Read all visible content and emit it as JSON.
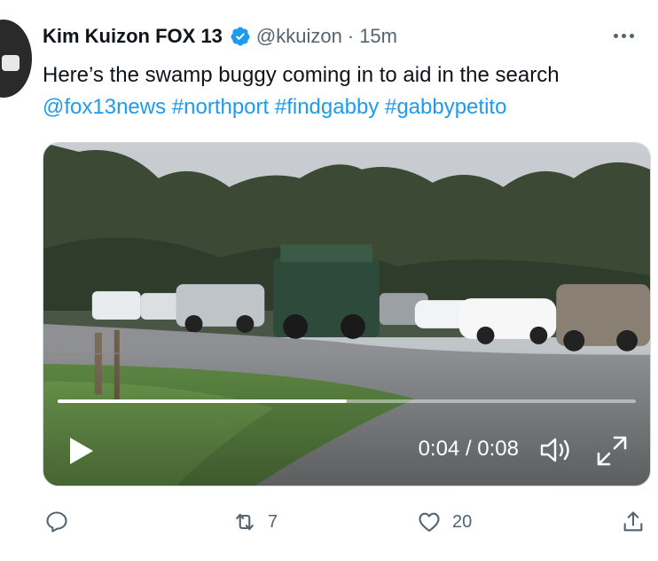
{
  "tweet": {
    "author_name": "Kim Kuizon FOX 13",
    "handle": "@kkuizon",
    "separator": "·",
    "time": "15m",
    "text": "Here’s the swamp buggy coming in to aid in the search",
    "hashtags": [
      "@fox13news",
      "#northport",
      "#findgabby",
      "#gabbypetito"
    ]
  },
  "video": {
    "timecode": "0:04 / 0:08",
    "progress": 0.5
  },
  "actions": {
    "reply_count": "",
    "retweet_count": "7",
    "like_count": "20"
  },
  "colors": {
    "link": "#1d9bf0",
    "secondary_text": "#536471",
    "verified": "#1d9bf0"
  },
  "icons": [
    "verified-badge-icon",
    "more-icon",
    "play-icon",
    "volume-icon",
    "fullscreen-icon",
    "reply-icon",
    "retweet-icon",
    "like-icon",
    "share-icon"
  ]
}
